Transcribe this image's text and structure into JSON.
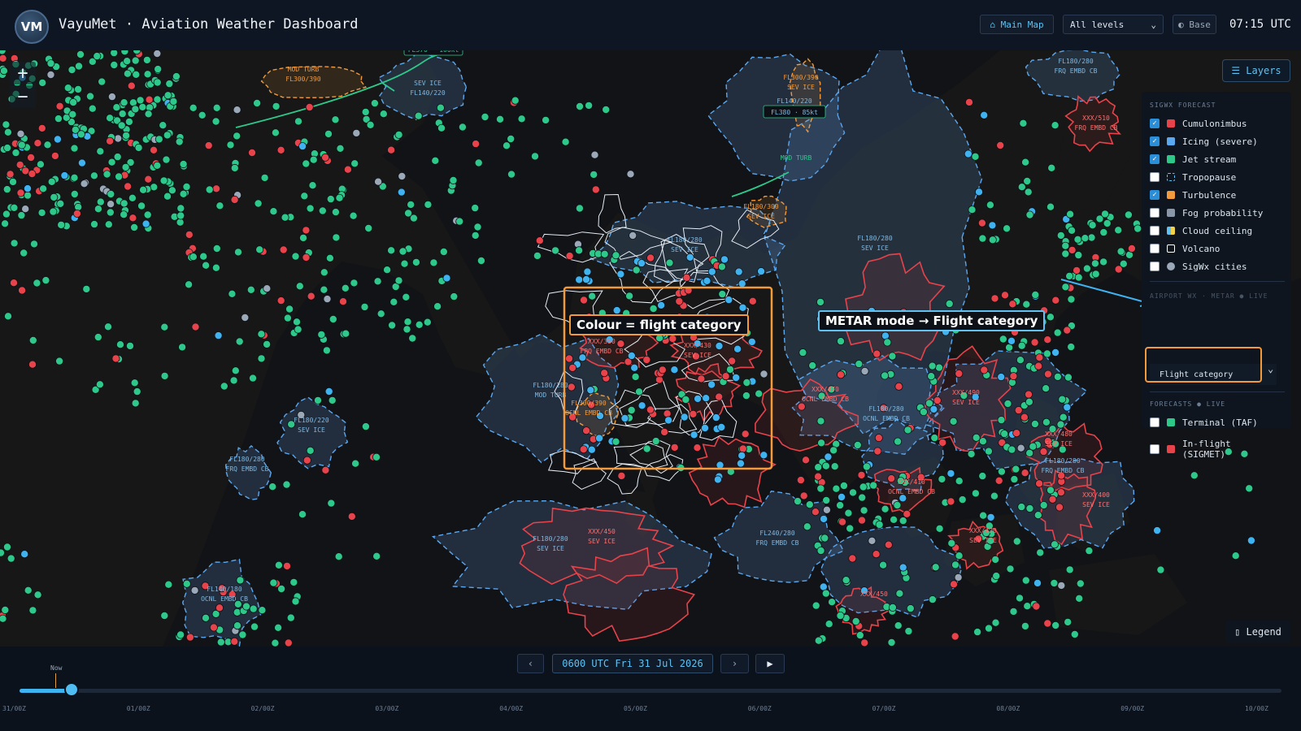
{
  "header": {
    "logo": "VM",
    "title": "VayuMet · Aviation Weather Dashboard",
    "main_map_label": "⌂ Main Map",
    "level_select": "All levels",
    "base_label": "◐ Base",
    "clock": "07:15 UTC"
  },
  "map": {
    "zoom_in": "+",
    "zoom_out": "−",
    "layers_button": "☰ Layers",
    "legend_button": "▯ Legend",
    "callouts": {
      "flight_category": "Colour = flight category",
      "metar_mode": "METAR mode → Flight category"
    },
    "labels": [
      "MOD TURB",
      "FL300/390",
      "SEV ICE",
      "FL140/220",
      "FL370 · 100kt",
      "MOD TURB",
      "FL300/390",
      "SEV ICE",
      "FL140/220",
      "FL380 · 85kt",
      "MOD TURB",
      "FL180/300",
      "SEV ICE",
      "FL180/280",
      "SEV ICE",
      "FL180/280",
      "SEV ICE",
      "FL180/280",
      "FRQ EMBD CB",
      "XXX/510",
      "FRQ EMBD CB",
      "XXX/350",
      "FRQ EMBD CB",
      "XXX/430",
      "SEV ICE",
      "FL180/280",
      "MOD TURB",
      "FL300/390",
      "OCNL EMBD CB",
      "XXX/470",
      "OCNL EMBD CB",
      "XXX/490",
      "SEV ICE",
      "FL180/280",
      "OCNL EMBD CB",
      "XXX/480",
      "SEV ICE",
      "FL180/280",
      "FRQ EMBD CB",
      "XXX/410",
      "OCNL EMBD CB",
      "XXX/400",
      "SEV ICE",
      "FL180/220",
      "SEV ICE",
      "FL180/280",
      "FRQ EMBD CB",
      "XXX/450",
      "SEV ICE",
      "FL180/280",
      "SEV ICE",
      "FL240/280",
      "FRQ EMBD CB",
      "XXX/420",
      "SEV ICE",
      "FL140/180",
      "OCNL EMBD CB",
      "XXX/450"
    ]
  },
  "layers": {
    "sigwx_heading": "SIGWX FORECAST",
    "items": [
      {
        "label": "Cumulonimbus",
        "checked": true,
        "color": "#e8424a"
      },
      {
        "label": "Icing (severe)",
        "checked": true,
        "color": "#5aa8f0"
      },
      {
        "label": "Jet stream",
        "checked": true,
        "color": "#2ec98a"
      },
      {
        "label": "Tropopause",
        "checked": false,
        "color": "#5fc2f2"
      },
      {
        "label": "Turbulence",
        "checked": true,
        "color": "#f29a3c"
      },
      {
        "label": "Fog probability",
        "checked": false,
        "color": "#8a97a8"
      },
      {
        "label": "Cloud ceiling",
        "checked": false,
        "color": "#5fc2f2"
      },
      {
        "label": "Volcano",
        "checked": false,
        "color": "#ffffff"
      },
      {
        "label": "SigWx cities",
        "checked": false,
        "color": "#9aa8b8"
      }
    ],
    "airport_heading": "AIRPORT WX · METAR ● LIVE",
    "airport_select": "Flight category",
    "forecast_heading": "FORECASTS ● LIVE",
    "forecasts": [
      {
        "label": "Terminal (TAF)",
        "checked": false,
        "color": "#2ec98a"
      },
      {
        "label": "In-flight\n(SIGMET)",
        "checked": false,
        "color": "#e8424a"
      }
    ]
  },
  "timeline": {
    "prev": "‹",
    "datetime": "0600 UTC Fri 31 Jul 2026",
    "next": "›",
    "play": "▶",
    "now_label": "Now",
    "progress": 0.028,
    "ticks": [
      "31/00Z",
      "01/00Z",
      "02/00Z",
      "03/00Z",
      "04/00Z",
      "05/00Z",
      "06/00Z",
      "07/00Z",
      "08/00Z",
      "09/00Z",
      "10/00Z"
    ]
  }
}
